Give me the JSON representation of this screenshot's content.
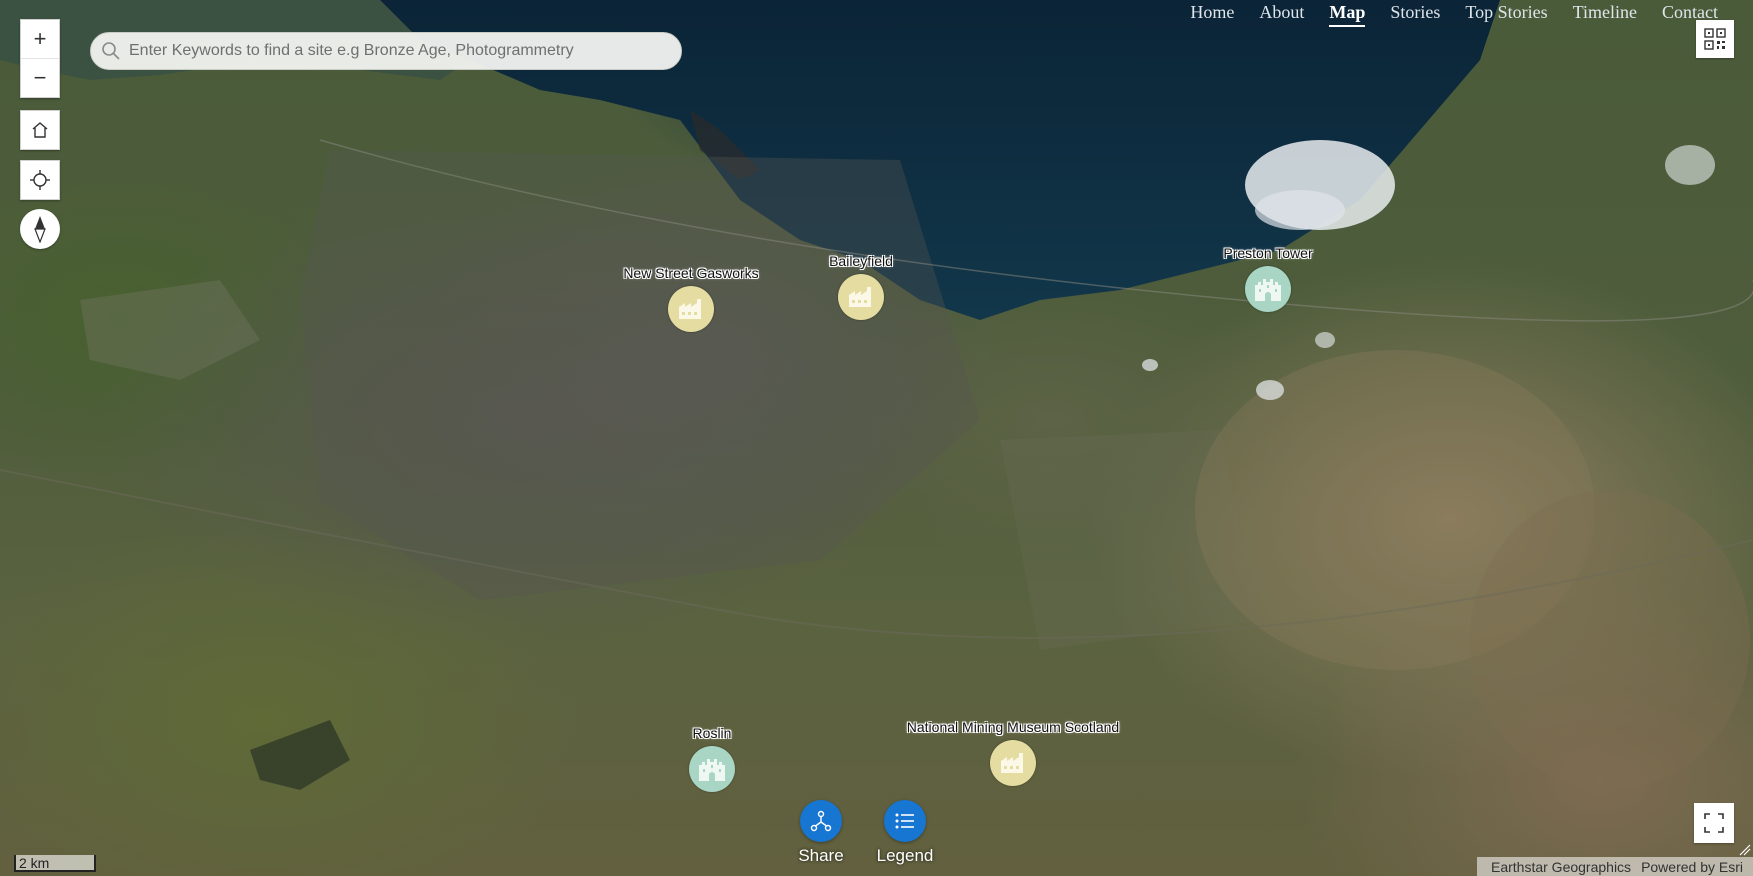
{
  "nav": {
    "items": [
      {
        "label": "Home",
        "active": false
      },
      {
        "label": "About",
        "active": false
      },
      {
        "label": "Map",
        "active": true
      },
      {
        "label": "Stories",
        "active": false
      },
      {
        "label": "Top Stories",
        "active": false
      },
      {
        "label": "Timeline",
        "active": false
      },
      {
        "label": "Contact",
        "active": false
      }
    ]
  },
  "search": {
    "placeholder": "Enter Keywords to find a site e.g Bronze Age, Photogrammetry",
    "icon": "search-icon"
  },
  "controls": {
    "zoom_in": "+",
    "zoom_out": "−",
    "home_icon": "home-icon",
    "locate_icon": "locate-icon",
    "compass_icon": "compass-icon",
    "qr_icon": "qr-code-icon",
    "fullscreen_icon": "fullscreen-icon"
  },
  "markers": [
    {
      "name": "New Street Gasworks",
      "type": "industrial",
      "icon": "factory-icon"
    },
    {
      "name": "Baileyfield",
      "type": "industrial",
      "icon": "factory-icon"
    },
    {
      "name": "Preston Tower",
      "type": "castle",
      "icon": "castle-icon"
    },
    {
      "name": "Roslin",
      "type": "castle",
      "icon": "castle-icon"
    },
    {
      "name": "National Mining Museum Scotland",
      "type": "industrial",
      "icon": "factory-icon"
    }
  ],
  "marker_colors": {
    "industrial": "#e4dca0",
    "castle": "#a9d5c4"
  },
  "actions": {
    "share_label": "Share",
    "legend_label": "Legend",
    "button_color": "#1676d2"
  },
  "scale": {
    "label": "2 km"
  },
  "attribution": {
    "source": "Earthstar Geographics",
    "powered": "Powered by Esri"
  }
}
